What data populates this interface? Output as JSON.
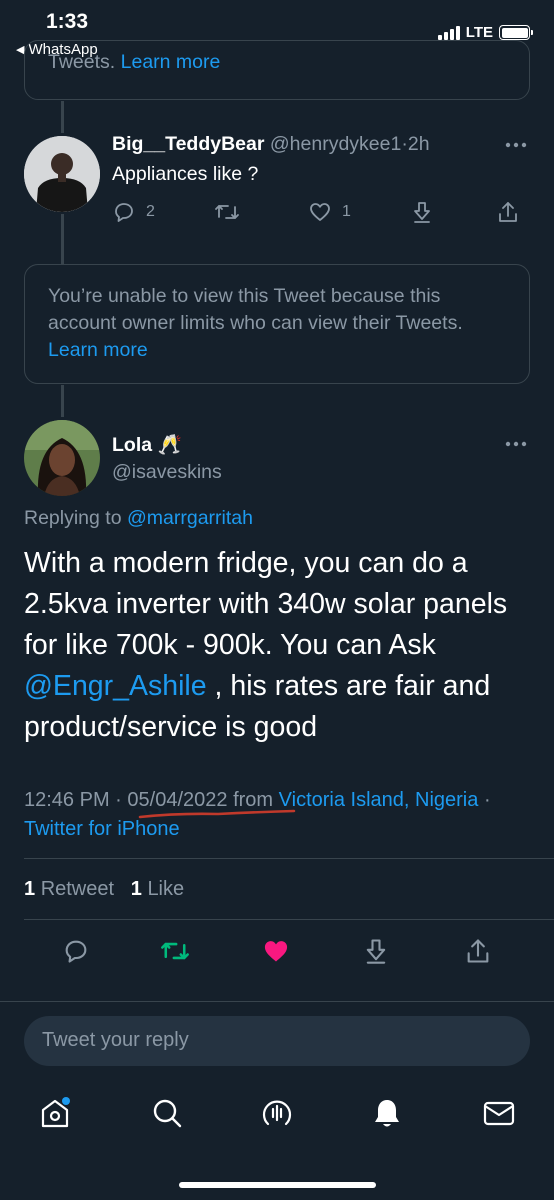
{
  "status_bar": {
    "time": "1:33",
    "back_app": "WhatsApp",
    "network": "LTE"
  },
  "top_partial_box": {
    "text": "Tweets.",
    "link": "Learn more"
  },
  "reply_tweet": {
    "display_name": "Big__TeddyBear",
    "handle": "@henrydykee1",
    "separator": "·",
    "time_ago": "2h",
    "text": "Appliances like ?",
    "reply_count": "2",
    "like_count": "1"
  },
  "hidden_notice": {
    "text": "You’re unable to view this Tweet because this account owner limits who can view their Tweets.",
    "link": "Learn more"
  },
  "main_tweet": {
    "display_name": "Lola",
    "name_emoji": "🥂",
    "handle": "@isaveskins",
    "replying_prefix": "Replying to",
    "replying_to": "@marrgarritah",
    "text_part1": "With a modern fridge, you can do a 2.5kva inverter with 340w solar panels for like 700k - 900k. You can Ask",
    "mention": "@Engr_Ashile",
    "text_part2": ", his rates are fair and product/service is good",
    "time": "12:46 PM",
    "dot": "·",
    "date": "05/04/2022",
    "from_word": "from",
    "location": "Victoria Island, Nigeria",
    "source": "Twitter for iPhone",
    "retweet_count": "1",
    "retweet_label": "Retweet",
    "like_count": "1",
    "like_label": "Like"
  },
  "reply_input": {
    "placeholder": "Tweet your reply"
  },
  "colors": {
    "background": "#15202b",
    "link": "#1d9bf0",
    "muted": "#8b98a5",
    "retweet_active": "#00ba7c",
    "like_active": "#f91880",
    "annotation_underline": "#c0392b"
  },
  "icons": {
    "reply": "reply-icon",
    "retweet": "retweet-icon",
    "like": "heart-icon",
    "download": "download-icon",
    "share": "share-icon",
    "nav": [
      "home-icon",
      "search-icon",
      "spaces-icon",
      "notifications-icon",
      "messages-icon"
    ]
  }
}
